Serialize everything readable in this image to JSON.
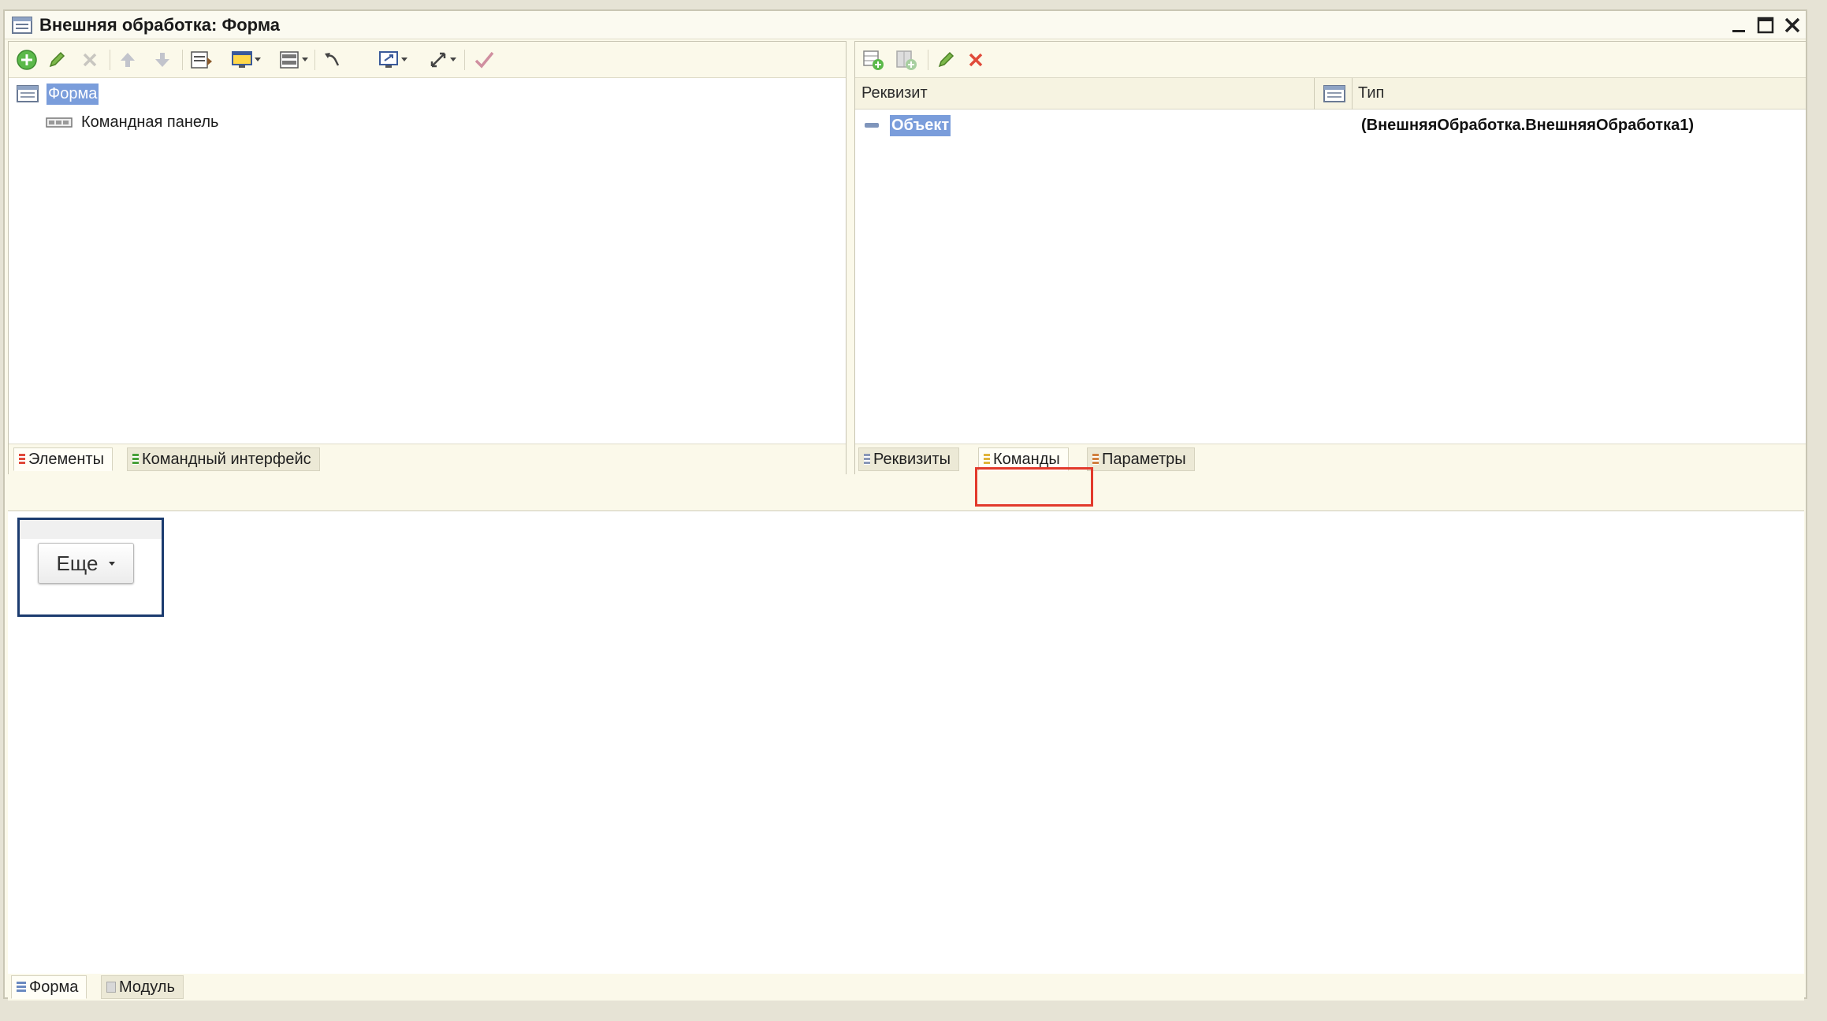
{
  "window": {
    "title": "Внешняя обработка: Форма"
  },
  "left_panel": {
    "tree": {
      "root_label": "Форма",
      "child_label": "Командная панель"
    },
    "tabs": [
      {
        "label": "Элементы",
        "active": true
      },
      {
        "label": "Командный интерфейс",
        "active": false
      }
    ]
  },
  "right_panel": {
    "columns": {
      "attribute": "Реквизит",
      "type": "Тип"
    },
    "rows": [
      {
        "name": "Объект",
        "type": "(ВнешняяОбработка.ВнешняяОбработка1)"
      }
    ],
    "tabs": [
      {
        "label": "Реквизиты",
        "active": false
      },
      {
        "label": "Команды",
        "active": true
      },
      {
        "label": "Параметры",
        "active": false
      }
    ]
  },
  "preview": {
    "more_button_label": "Еще"
  },
  "bottom_tabs": [
    {
      "label": "Форма",
      "active": true
    },
    {
      "label": "Модуль",
      "active": false
    }
  ],
  "colors": {
    "selection": "#7a9ddb",
    "highlight_box": "#e23a2c",
    "frame_bg": "#fbf9ea"
  }
}
